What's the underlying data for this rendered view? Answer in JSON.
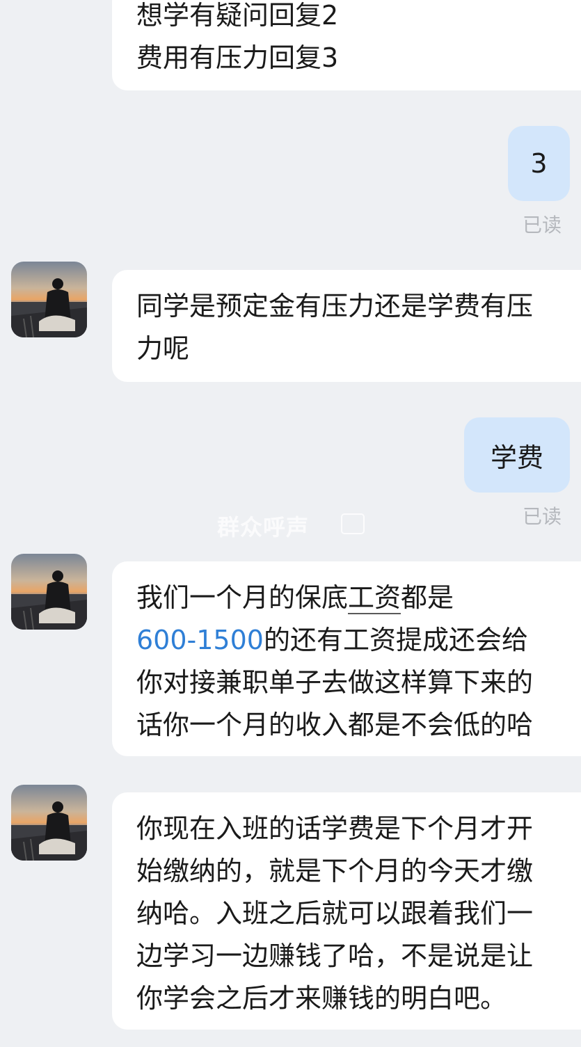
{
  "messages": {
    "m1": {
      "lines": [
        "想学有疑问回复2",
        "费用有压力回复3"
      ]
    },
    "m2": {
      "text": "3",
      "status": "已读"
    },
    "m3": {
      "lines": [
        "同学是预定金有压力还是学费有压",
        "力呢"
      ]
    },
    "m4": {
      "text": "学费",
      "status": "已读"
    },
    "m5": {
      "line1_a": "我们一个月的保底",
      "line1_b": "工资",
      "line1_c": "都是",
      "line2_link": "600-1500",
      "line2_rest": "的还有工资提成还会给",
      "line3": "你对接兼职单子去做这样算下来的",
      "line4": "话你一个月的收入都是不会低的哈"
    },
    "m6": {
      "lines": [
        "你现在入班的话学费是下个月才开",
        "始缴纳的，就是下个月的今天才缴",
        "纳哈。入班之后就可以跟着我们一",
        "边学习一边赚钱了哈，不是说是让",
        "你学会之后才来赚钱的明白吧。"
      ]
    }
  },
  "watermark": "群众呼声",
  "colors": {
    "background": "#eef0f3",
    "incoming_bubble": "#ffffff",
    "outgoing_bubble": "#d3e6fb",
    "link": "#2f7fd6",
    "read_status": "#b5b8bd"
  },
  "icons": {
    "avatar": "sunset-person-avatar-icon"
  }
}
